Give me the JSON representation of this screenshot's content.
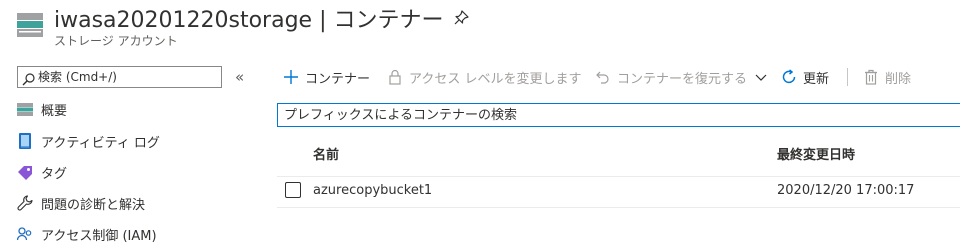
{
  "header": {
    "title": "iwasa20201220storage | コンテナー",
    "subtitle": "ストレージ アカウント",
    "icon": "storage-account-icon",
    "pin_icon": "pin-icon"
  },
  "sidebar": {
    "search_placeholder": "検索 (Cmd+/)",
    "collapse_label": "«",
    "items": [
      {
        "label": "概要",
        "icon": "overview-icon"
      },
      {
        "label": "アクティビティ ログ",
        "icon": "activity-log-icon"
      },
      {
        "label": "タグ",
        "icon": "tag-icon"
      },
      {
        "label": "問題の診断と解決",
        "icon": "wrench-icon"
      },
      {
        "label": "アクセス制御 (IAM)",
        "icon": "access-control-icon"
      }
    ]
  },
  "toolbar": {
    "add_container": "コンテナー",
    "change_access_level": "アクセス レベルを変更します",
    "restore_containers": "コンテナーを復元する",
    "refresh": "更新",
    "delete": "削除"
  },
  "container_search": {
    "placeholder": "プレフィックスによるコンテナーの検索"
  },
  "table": {
    "columns": [
      "名前",
      "最終変更日時"
    ],
    "rows": [
      {
        "name": "azurecopybucket1",
        "last_modified": "2020/12/20 17:00:17"
      }
    ]
  },
  "colors": {
    "accent": "#0078d4",
    "text": "#323130",
    "disabled": "#a19f9d",
    "storage_teal": "#3fa39b"
  }
}
